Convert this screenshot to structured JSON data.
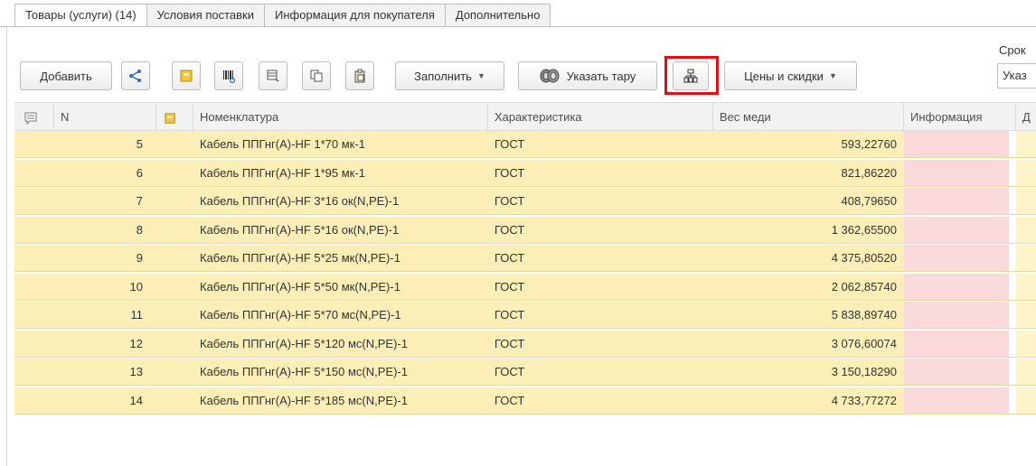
{
  "tabs": [
    {
      "label": "Товары (услуги) (14)",
      "active": true
    },
    {
      "label": "Условия поставки",
      "active": false
    },
    {
      "label": "Информация для покупателя",
      "active": false
    },
    {
      "label": "Дополнительно",
      "active": false
    }
  ],
  "toolbar": {
    "add_label": "Добавить",
    "fill_label": "Заполнить",
    "tare_label": "Указать тару",
    "prices_label": "Цены и скидки",
    "srok_label": "Срок",
    "srok_value": "Указ"
  },
  "columns": {
    "n": "N",
    "nomenclature": "Номенклатура",
    "characteristic": "Характеристика",
    "copper_weight": "Вес меди",
    "info": "Информация",
    "d": "Д"
  },
  "rows": [
    {
      "n": "5",
      "nomenclature": "Кабель ППГнг(А)-HF 1*70 мк-1",
      "characteristic": "ГОСТ",
      "copper_weight": "593,22760"
    },
    {
      "n": "6",
      "nomenclature": "Кабель ППГнг(А)-HF 1*95 мк-1",
      "characteristic": "ГОСТ",
      "copper_weight": "821,86220"
    },
    {
      "n": "7",
      "nomenclature": "Кабель ППГнг(А)-HF 3*16 ок(N,PE)-1",
      "characteristic": "ГОСТ",
      "copper_weight": "408,79650"
    },
    {
      "n": "8",
      "nomenclature": "Кабель ППГнг(А)-HF 5*16 ок(N,PE)-1",
      "characteristic": "ГОСТ",
      "copper_weight": "1 362,65500"
    },
    {
      "n": "9",
      "nomenclature": "Кабель ППГнг(А)-HF 5*25 мк(N,PE)-1",
      "characteristic": "ГОСТ",
      "copper_weight": "4 375,80520"
    },
    {
      "n": "10",
      "nomenclature": "Кабель ППГнг(А)-HF 5*50 мк(N,PE)-1",
      "characteristic": "ГОСТ",
      "copper_weight": "2 062,85740"
    },
    {
      "n": "11",
      "nomenclature": "Кабель ППГнг(А)-HF 5*70 мс(N,PE)-1",
      "characteristic": "ГОСТ",
      "copper_weight": "5 838,89740"
    },
    {
      "n": "12",
      "nomenclature": "Кабель ППГнг(А)-HF 5*120 мс(N,PE)-1",
      "characteristic": "ГОСТ",
      "copper_weight": "3 076,60074"
    },
    {
      "n": "13",
      "nomenclature": "Кабель ППГнг(А)-HF 5*150 мс(N,PE)-1",
      "characteristic": "ГОСТ",
      "copper_weight": "3 150,18290"
    },
    {
      "n": "14",
      "nomenclature": "Кабель ППГнг(А)-HF 5*185 мс(N,PE)-1",
      "characteristic": "ГОСТ",
      "copper_weight": "4 733,77272"
    }
  ],
  "colors": {
    "row_background": "#fbeeb7",
    "info_cell_background": "#f9d9d9",
    "highlight_border": "#e01010"
  }
}
